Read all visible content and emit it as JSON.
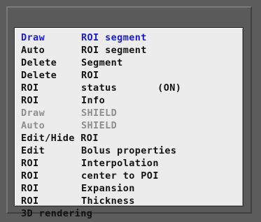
{
  "menu": {
    "items": [
      {
        "verb": "Draw",
        "object": "ROI segment",
        "state": "highlighted"
      },
      {
        "verb": "Auto",
        "object": "ROI segment",
        "state": "normal"
      },
      {
        "verb": "Delete",
        "object": "Segment",
        "state": "normal"
      },
      {
        "verb": "Delete",
        "object": "ROI",
        "state": "normal"
      },
      {
        "verb": "ROI",
        "object": "status",
        "status": "(ON)",
        "state": "normal"
      },
      {
        "verb": "ROI",
        "object": "Info",
        "state": "normal"
      },
      {
        "verb": "Draw",
        "object": "SHIELD",
        "state": "disabled"
      },
      {
        "verb": "Auto",
        "object": "SHIELD",
        "state": "disabled"
      },
      {
        "label": "Edit/Hide ROI",
        "state": "normal"
      },
      {
        "verb": "Edit",
        "object": "Bolus properties",
        "state": "normal"
      },
      {
        "verb": "ROI",
        "object": "Interpolation",
        "state": "normal"
      },
      {
        "verb": "ROI",
        "object": "center to POI",
        "state": "normal"
      },
      {
        "verb": "ROI",
        "object": "Expansion",
        "state": "normal"
      },
      {
        "verb": "ROI",
        "object": "Thickness",
        "state": "normal"
      },
      {
        "label": "3D rendering",
        "state": "normal"
      }
    ],
    "colors": {
      "highlight": "#1a1ad6",
      "normal": "#111111",
      "disabled": "#8e8e8e",
      "panel_background": "#ececec",
      "frame_background": "#5c5c5c"
    }
  }
}
